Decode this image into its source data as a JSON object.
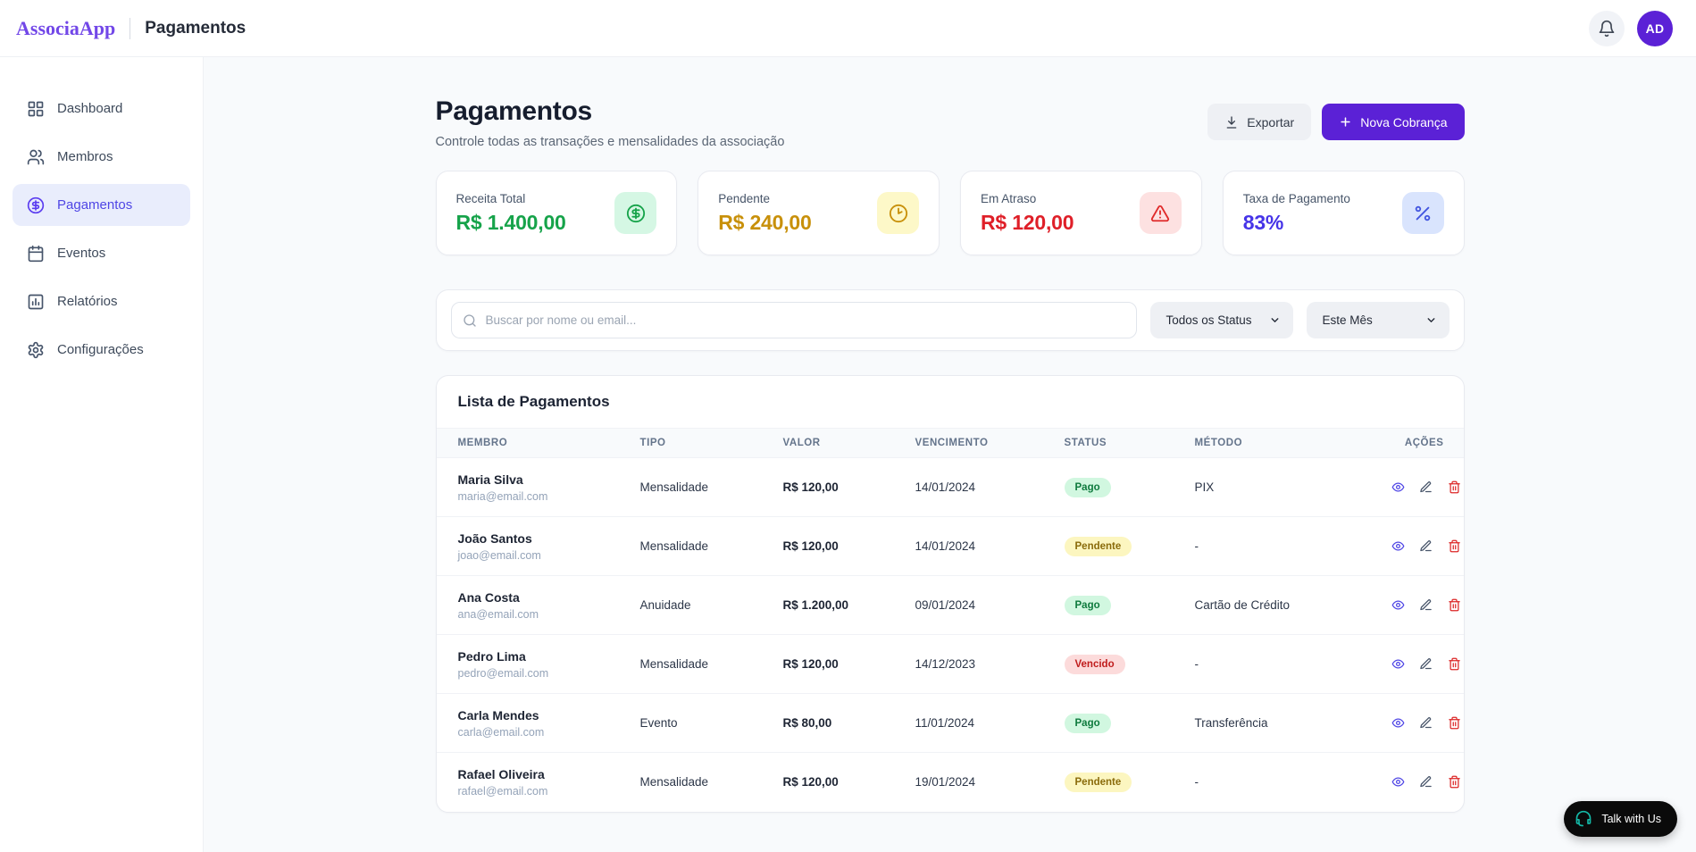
{
  "header": {
    "logo": "AssociaApp",
    "title": "Pagamentos",
    "avatar_initials": "AD"
  },
  "sidebar": {
    "items": [
      {
        "label": "Dashboard",
        "icon": "dashboard-grid-icon",
        "active": false
      },
      {
        "label": "Membros",
        "icon": "users-icon",
        "active": false
      },
      {
        "label": "Pagamentos",
        "icon": "dollar-circle-icon",
        "active": true
      },
      {
        "label": "Eventos",
        "icon": "calendar-icon",
        "active": false
      },
      {
        "label": "Relatórios",
        "icon": "bar-chart-icon",
        "active": false
      },
      {
        "label": "Configurações",
        "icon": "gear-icon",
        "active": false
      }
    ]
  },
  "page": {
    "title": "Pagamentos",
    "subtitle": "Controle todas as transações e mensalidades da associação",
    "export_label": "Exportar",
    "new_charge_label": "Nova Cobrança"
  },
  "stats": [
    {
      "label": "Receita Total",
      "value": "R$ 1.400,00",
      "icon": "dollar-circle-icon",
      "color": "#16a34a"
    },
    {
      "label": "Pendente",
      "value": "R$ 240,00",
      "icon": "clock-icon",
      "color": "#c8900a"
    },
    {
      "label": "Em Atraso",
      "value": "R$ 120,00",
      "icon": "alert-triangle-icon",
      "color": "#df1f28"
    },
    {
      "label": "Taxa de Pagamento",
      "value": "83%",
      "icon": "percent-icon",
      "color": "#4634e8"
    }
  ],
  "filters": {
    "search_placeholder": "Buscar por nome ou email...",
    "status_selected": "Todos os Status",
    "period_selected": "Este Mês"
  },
  "table": {
    "title": "Lista de Pagamentos",
    "columns": [
      "Membro",
      "Tipo",
      "Valor",
      "Vencimento",
      "Status",
      "Método",
      "Ações"
    ],
    "rows": [
      {
        "name": "Maria Silva",
        "email": "maria@email.com",
        "tipo": "Mensalidade",
        "valor": "R$ 120,00",
        "vencimento": "14/01/2024",
        "status": "Pago",
        "metodo": "PIX"
      },
      {
        "name": "João Santos",
        "email": "joao@email.com",
        "tipo": "Mensalidade",
        "valor": "R$ 120,00",
        "vencimento": "14/01/2024",
        "status": "Pendente",
        "metodo": "-"
      },
      {
        "name": "Ana Costa",
        "email": "ana@email.com",
        "tipo": "Anuidade",
        "valor": "R$ 1.200,00",
        "vencimento": "09/01/2024",
        "status": "Pago",
        "metodo": "Cartão de Crédito"
      },
      {
        "name": "Pedro Lima",
        "email": "pedro@email.com",
        "tipo": "Mensalidade",
        "valor": "R$ 120,00",
        "vencimento": "14/12/2023",
        "status": "Vencido",
        "metodo": "-"
      },
      {
        "name": "Carla Mendes",
        "email": "carla@email.com",
        "tipo": "Evento",
        "valor": "R$ 80,00",
        "vencimento": "11/01/2024",
        "status": "Pago",
        "metodo": "Transferência"
      },
      {
        "name": "Rafael Oliveira",
        "email": "rafael@email.com",
        "tipo": "Mensalidade",
        "valor": "R$ 120,00",
        "vencimento": "19/01/2024",
        "status": "Pendente",
        "metodo": "-"
      }
    ]
  },
  "chat": {
    "label": "Talk with Us"
  },
  "colors": {
    "accent": "#5b21d6",
    "accent_active_nav": "#4f46e5",
    "positive": "#16a34a",
    "warning": "#c8900a",
    "danger": "#df1f28",
    "info": "#4634e8",
    "chat_icon": "#14b8a6"
  }
}
